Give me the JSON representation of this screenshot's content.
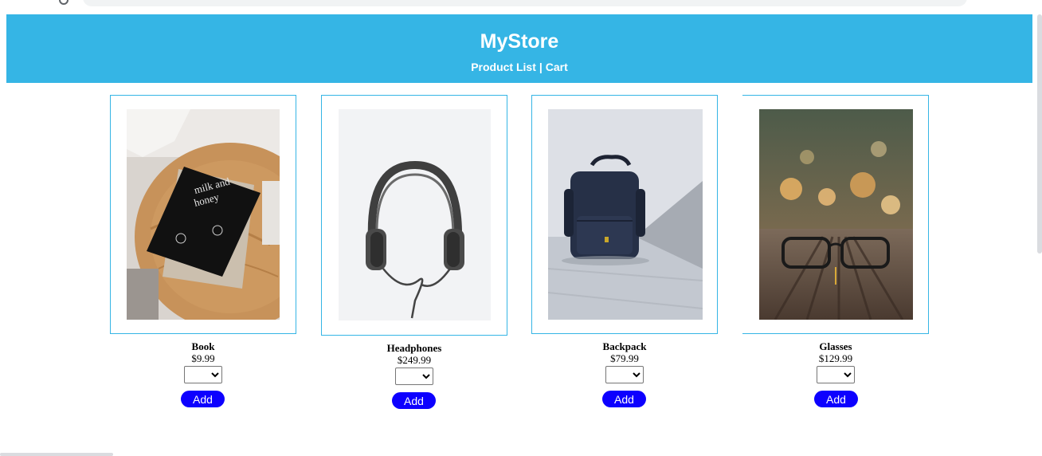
{
  "store": {
    "title": "MyStore",
    "nav": {
      "product_list": "Product List",
      "separator": "|",
      "cart": "Cart"
    }
  },
  "colors": {
    "header_bg": "#35b5e5",
    "card_border": "#35b5e5",
    "add_button": "#0d00ff"
  },
  "products": [
    {
      "name": "Book",
      "price": "$9.99",
      "quantity": "",
      "add_label": "Add",
      "image": "book-photo"
    },
    {
      "name": "Headphones",
      "price": "$249.99",
      "quantity": "",
      "add_label": "Add",
      "image": "headphones-photo"
    },
    {
      "name": "Backpack",
      "price": "$79.99",
      "quantity": "",
      "add_label": "Add",
      "image": "backpack-photo"
    },
    {
      "name": "Glasses",
      "price": "$129.99",
      "quantity": "",
      "add_label": "Add",
      "image": "glasses-photo"
    }
  ]
}
